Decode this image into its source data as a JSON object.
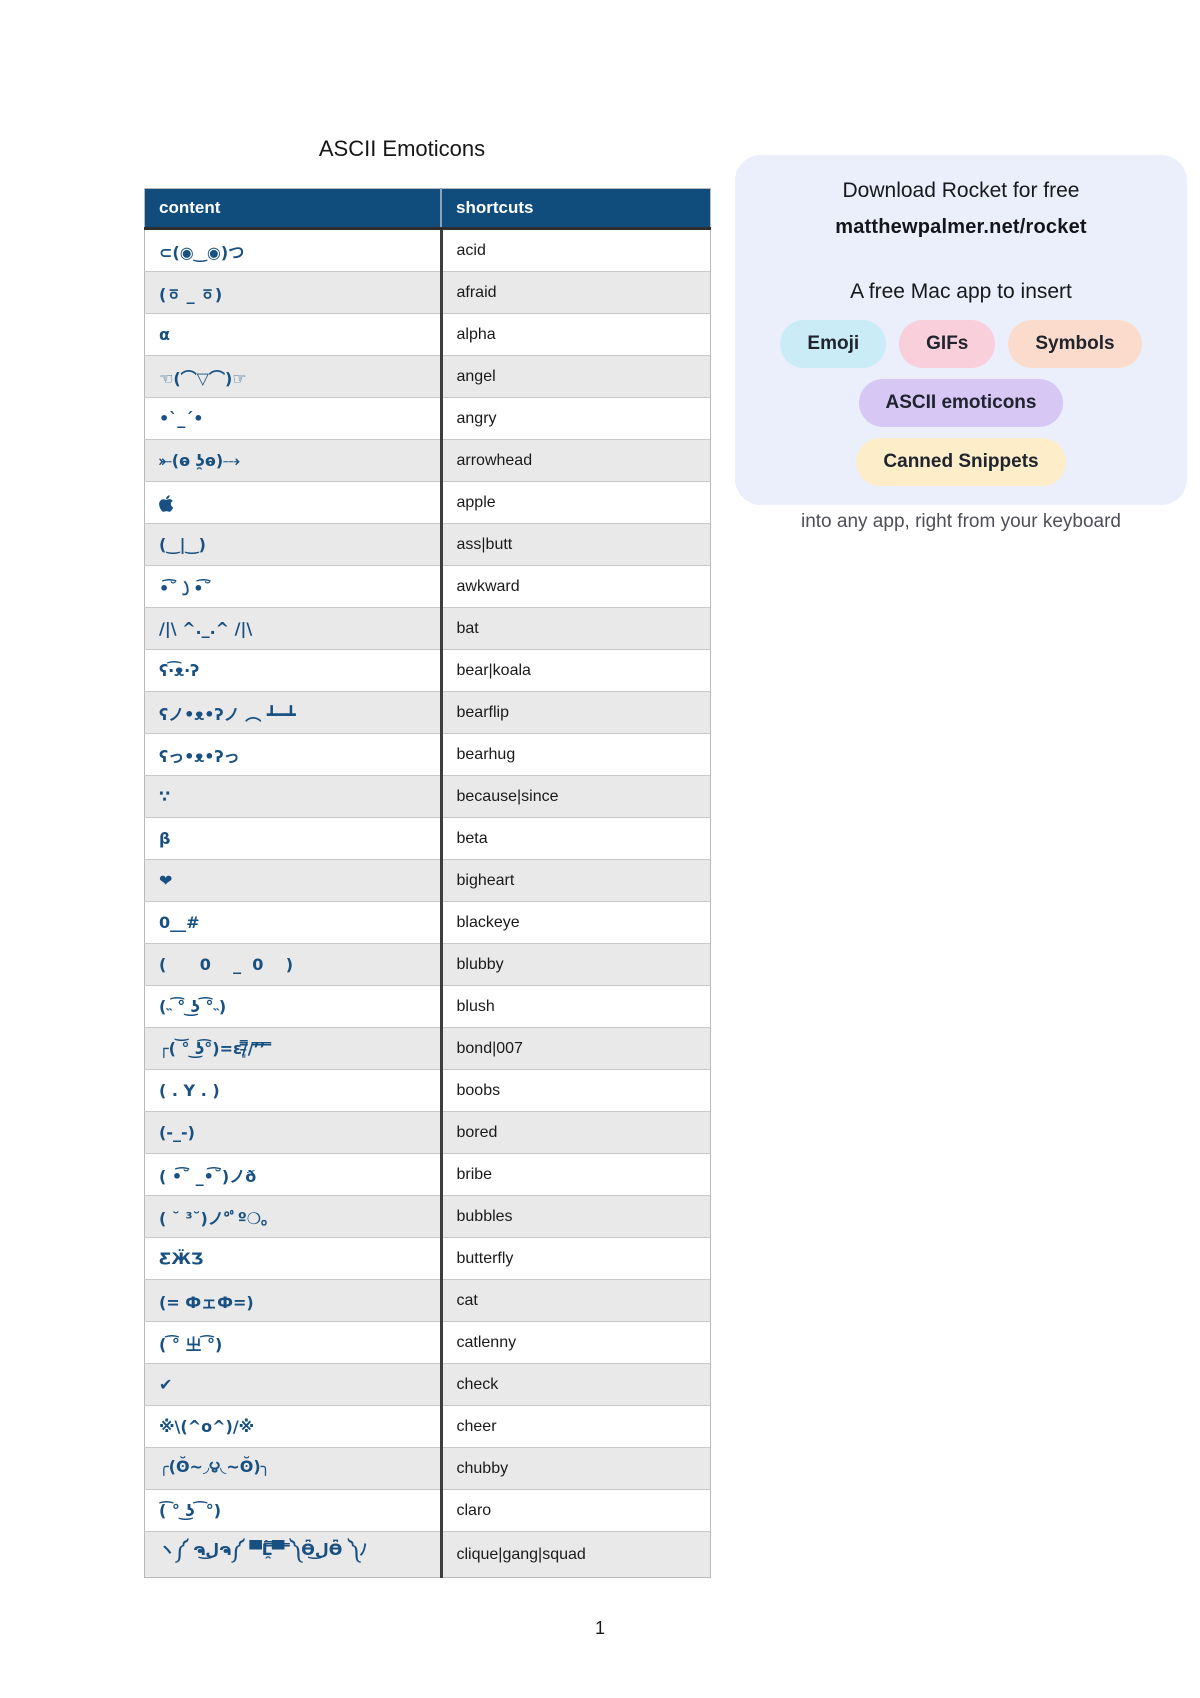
{
  "title": "ASCII Emoticons",
  "table": {
    "header_bg": "#114d7c",
    "content_color": "#175081",
    "alt_row_bg": "#e9e9e9",
    "headers": {
      "content": "content",
      "shortcuts": "shortcuts"
    },
    "rows": [
      {
        "content": "⊂(◉‿◉)つ",
        "shortcut": "acid"
      },
      {
        "content": "(ㆆ _ ㆆ)",
        "shortcut": "afraid"
      },
      {
        "content": "α",
        "shortcut": "alpha"
      },
      {
        "content": "☜(⌒▽⌒)☞",
        "shortcut": "angel"
      },
      {
        "content": "•`_´•",
        "shortcut": "angry"
      },
      {
        "content": "⤜(ⱺ ʖ̯ⱺ)⤏",
        "shortcut": "arrowhead"
      },
      {
        "content": "",
        "shortcut": "apple",
        "icon": "apple-logo-icon"
      },
      {
        "content": "(‿|‿)",
        "shortcut": "ass|butt"
      },
      {
        "content": "•͡˘㇁•͡˘",
        "shortcut": "awkward"
      },
      {
        "content": "/|\\ ^._.^ /|\\",
        "shortcut": "bat"
      },
      {
        "content": "ʕ·͡ᴥ·ʔ",
        "shortcut": "bear|koala"
      },
      {
        "content": "ʕノ•ᴥ•ʔノ ︵ ┻━┻",
        "shortcut": "bearflip"
      },
      {
        "content": "ʕっ•ᴥ•ʔっ",
        "shortcut": "bearhug"
      },
      {
        "content": "∵",
        "shortcut": "because|since"
      },
      {
        "content": "β",
        "shortcut": "beta"
      },
      {
        "content": "❤",
        "shortcut": "bigheart"
      },
      {
        "content": "0__#",
        "shortcut": "blackeye"
      },
      {
        "content": "(      0    _  0    )",
        "shortcut": "blubby"
      },
      {
        "content": "(˵ ͡° ͜ʖ ͡°˵)",
        "shortcut": "blush"
      },
      {
        "content": "┌( ͝° ͜ʖ͡°)=ε/̵͇̿̿/’̿’̿ ̿",
        "shortcut": "bond|007"
      },
      {
        "content": "( . Y . )",
        "shortcut": "boobs"
      },
      {
        "content": "(-_-)",
        "shortcut": "bored"
      },
      {
        "content": "( •͡˘ _•͡˘)ノð",
        "shortcut": "bribe"
      },
      {
        "content": "( ˘ ³˘)ノ°ﾟº❍｡",
        "shortcut": "bubbles"
      },
      {
        "content": "ƸӜƷ",
        "shortcut": "butterfly"
      },
      {
        "content": "(= ФェФ=)",
        "shortcut": "cat"
      },
      {
        "content": "( ͡° 㞢 ͡°)",
        "shortcut": "catlenny"
      },
      {
        "content": "✔",
        "shortcut": "check"
      },
      {
        "content": "※\\(^o^)/※",
        "shortcut": "cheer"
      },
      {
        "content": "╭(ʘ̆~◞౪◟~ʘ̆)╮",
        "shortcut": "chubby"
      },
      {
        "content": "(͡ ° ͜ʖ ͡ °)",
        "shortcut": "claro"
      },
      {
        "content": "ヽ༼ ຈل͜ຈ༼ ▀̿̿Ĺ̯̿̿▀̿ ̿༽Ɵ͆ل͜Ɵ͆ ༽ﾉ",
        "shortcut": "clique|gang|squad"
      }
    ]
  },
  "panel": {
    "bg": "#ebeefb",
    "heading": "Download Rocket for free",
    "link": "matthewpalmer.net/rocket",
    "subheading": "A free Mac app to insert",
    "pills": [
      {
        "label": "Emoji",
        "bg": "#c9ecf6"
      },
      {
        "label": "GIFs",
        "bg": "#f8cfda"
      },
      {
        "label": "Symbols",
        "bg": "#fbdccc"
      },
      {
        "label": "ASCII emoticons",
        "bg": "#d7c7f4"
      },
      {
        "label": "Canned Snippets",
        "bg": "#fdedc9"
      }
    ],
    "footer": "into any app, right from your keyboard"
  },
  "page": {
    "number": "1"
  }
}
